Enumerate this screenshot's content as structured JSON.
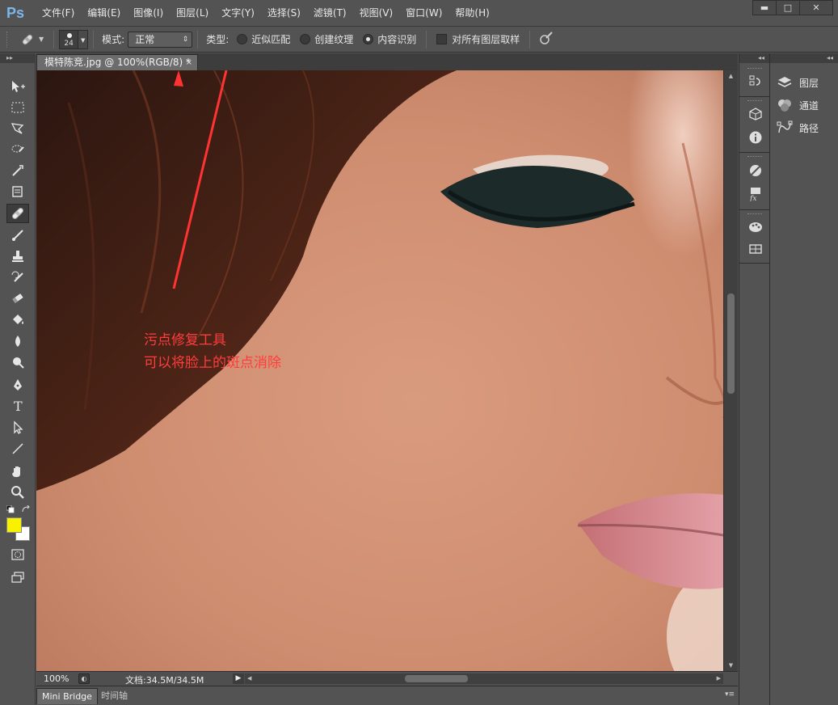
{
  "app": {
    "logo": "Ps"
  },
  "menu": [
    "文件(F)",
    "编辑(E)",
    "图像(I)",
    "图层(L)",
    "文字(Y)",
    "选择(S)",
    "滤镜(T)",
    "视图(V)",
    "窗口(W)",
    "帮助(H)"
  ],
  "window_controls": {
    "minimize": "▬",
    "maximize": "□",
    "close": "✕"
  },
  "options": {
    "brush_size": "24",
    "mode_label": "模式:",
    "mode_value": "正常",
    "type_label": "类型:",
    "type_options": [
      "近似匹配",
      "创建纹理",
      "内容识别"
    ],
    "type_selected": 2,
    "sample_all_layers": "对所有图层取样",
    "sample_all_checked": false
  },
  "document": {
    "tab_title": "模特陈竞.jpg @ 100%(RGB/8) *",
    "tab_close": "×",
    "zoom": "100%",
    "doc_size": "文档:34.5M/34.5M"
  },
  "annotation": {
    "line1": "污点修复工具",
    "line2": "可以将脸上的斑点消除",
    "color": "#ff3d3d"
  },
  "bottom_tabs": [
    "Mini Bridge",
    "时间轴"
  ],
  "panels": [
    "图层",
    "通道",
    "路径"
  ],
  "tools": [
    "move-icon",
    "marquee-icon",
    "lasso-icon",
    "quick-select-icon",
    "crop-icon",
    "eyedropper-icon",
    "spot-healing-icon",
    "brush-icon",
    "clone-stamp-icon",
    "history-brush-icon",
    "eraser-icon",
    "paint-bucket-icon",
    "blur-icon",
    "dodge-icon",
    "pen-icon",
    "type-icon",
    "path-select-icon",
    "line-icon",
    "hand-icon",
    "zoom-icon"
  ],
  "active_tool": "spot-healing-icon",
  "colors": {
    "foreground": "#f8f200",
    "background": "#ffffff",
    "accent": "#7cb7ea"
  }
}
